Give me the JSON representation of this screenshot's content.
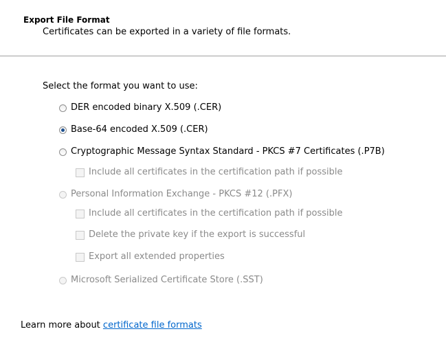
{
  "header": {
    "title": "Export File Format",
    "subtitle": "Certificates can be exported in a variety of file formats."
  },
  "main": {
    "prompt": "Select the format you want to use:",
    "options": [
      {
        "label": "DER encoded binary X.509 (.CER)",
        "checked": false,
        "enabled": true
      },
      {
        "label": "Base-64 encoded X.509 (.CER)",
        "checked": true,
        "enabled": true
      },
      {
        "label": "Cryptographic Message Syntax Standard - PKCS #7 Certificates (.P7B)",
        "checked": false,
        "enabled": true
      },
      {
        "label": "Personal Information Exchange - PKCS #12 (.PFX)",
        "checked": false,
        "enabled": false
      },
      {
        "label": "Microsoft Serialized Certificate Store (.SST)",
        "checked": false,
        "enabled": false
      }
    ],
    "checkboxes": [
      {
        "label": "Include all certificates in the certification path if possible",
        "checked": false,
        "enabled": false
      },
      {
        "label": "Include all certificates in the certification path if possible",
        "checked": false,
        "enabled": false
      },
      {
        "label": "Delete the private key if the export is successful",
        "checked": false,
        "enabled": false
      },
      {
        "label": "Export all extended properties",
        "checked": false,
        "enabled": false
      }
    ]
  },
  "footer": {
    "learn_prefix": "Learn more about ",
    "learn_link": "certificate file formats"
  },
  "colors": {
    "link": "#0066cc",
    "disabled_text": "#8a8a8a",
    "radio_dot": "#1c4f8e"
  }
}
